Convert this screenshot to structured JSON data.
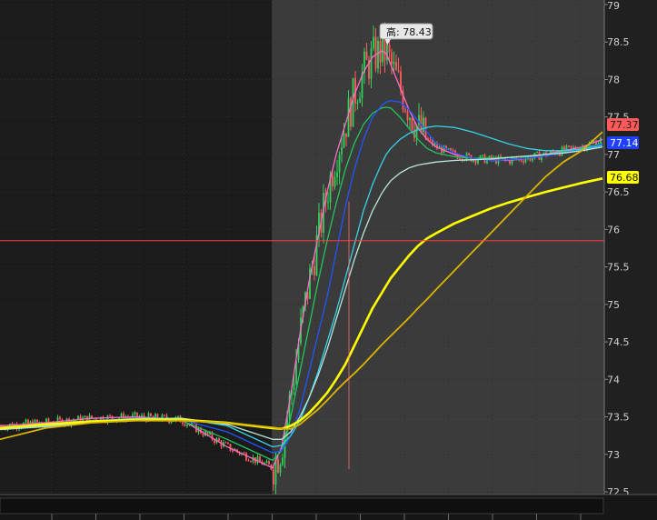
{
  "chart_data": {
    "type": "line",
    "title": "",
    "xlabel": "",
    "ylabel": "",
    "ylim": [
      72.5,
      79
    ],
    "y_ticks": [
      "72.5",
      "73",
      "73.5",
      "74",
      "74.5",
      "75",
      "75.5",
      "76",
      "76.5",
      "77",
      "77.5",
      "78",
      "78.5",
      "79"
    ],
    "grid": true,
    "high_annotation": "高: 78.43",
    "price_badges": [
      {
        "label": "77.37",
        "value": 77.37,
        "color": "#ff5a5a",
        "text_color": "#1a1a1a"
      },
      {
        "label": "77.14",
        "value": 77.14,
        "color": "#2040ff",
        "text_color": "#ffffff"
      },
      {
        "label": "76.68",
        "value": 76.68,
        "color": "#ffff00",
        "text_color": "#1a1a1a"
      }
    ],
    "reference_line": {
      "value": 75.85,
      "color": "#ff3b3b"
    },
    "x": [
      0,
      50,
      100,
      150,
      200,
      250,
      300,
      310,
      320,
      330,
      340,
      350,
      360,
      370,
      380,
      390,
      400,
      410,
      420,
      425,
      430,
      440,
      450,
      460,
      470,
      480,
      500,
      520,
      540,
      560,
      580,
      600,
      620,
      640,
      663
    ],
    "series": [
      {
        "name": "",
        "color": "#ff6ec7",
        "width": 1.3,
        "values": [
          73.38,
          73.42,
          73.48,
          73.5,
          73.46,
          73.1,
          72.82,
          73.1,
          73.8,
          74.6,
          75.3,
          75.9,
          76.5,
          77.0,
          77.4,
          77.8,
          78.1,
          78.3,
          78.38,
          78.35,
          78.2,
          77.9,
          77.6,
          77.35,
          77.2,
          77.1,
          77.0,
          76.95,
          76.93,
          76.92,
          76.95,
          77.0,
          77.05,
          77.1,
          77.2
        ]
      },
      {
        "name": "",
        "color": "#22c55e",
        "width": 1.3,
        "values": [
          73.35,
          73.4,
          73.45,
          73.47,
          73.45,
          73.2,
          72.92,
          73.05,
          73.5,
          74.1,
          74.7,
          75.3,
          75.85,
          76.35,
          76.8,
          77.15,
          77.4,
          77.55,
          77.62,
          77.63,
          77.62,
          77.5,
          77.35,
          77.2,
          77.08,
          77.02,
          76.97,
          76.95,
          76.95,
          76.96,
          76.97,
          77.0,
          77.03,
          77.08,
          77.15
        ]
      },
      {
        "name": "",
        "color": "#2255ff",
        "width": 1.3,
        "values": [
          73.36,
          73.4,
          73.45,
          73.48,
          73.46,
          73.3,
          73.02,
          73.05,
          73.25,
          73.6,
          74.1,
          74.6,
          75.1,
          75.7,
          76.3,
          76.8,
          77.2,
          77.5,
          77.65,
          77.7,
          77.72,
          77.7,
          77.6,
          77.45,
          77.3,
          77.15,
          77.02,
          76.95,
          76.92,
          76.93,
          76.95,
          76.98,
          77.02,
          77.07,
          77.14
        ]
      },
      {
        "name": "",
        "color": "#35d2e6",
        "width": 1.3,
        "values": [
          73.34,
          73.38,
          73.44,
          73.48,
          73.48,
          73.38,
          73.1,
          73.12,
          73.25,
          73.45,
          73.75,
          74.1,
          74.5,
          74.9,
          75.35,
          75.8,
          76.25,
          76.6,
          76.88,
          77.0,
          77.08,
          77.2,
          77.28,
          77.33,
          77.36,
          77.38,
          77.36,
          77.3,
          77.22,
          77.14,
          77.08,
          77.05,
          77.05,
          77.07,
          77.12
        ]
      },
      {
        "name": "",
        "color": "#b8e6dc",
        "width": 1.3,
        "values": [
          73.33,
          73.37,
          73.43,
          73.47,
          73.48,
          73.4,
          73.2,
          73.2,
          73.3,
          73.5,
          73.75,
          74.05,
          74.4,
          74.8,
          75.2,
          75.6,
          75.95,
          76.25,
          76.48,
          76.57,
          76.65,
          76.75,
          76.82,
          76.86,
          76.88,
          76.9,
          76.92,
          76.93,
          76.94,
          76.96,
          76.98,
          77.0,
          77.02,
          77.05,
          77.1
        ]
      },
      {
        "name": "",
        "color": "#ffff00",
        "width": 2.6,
        "values": [
          73.35,
          73.4,
          73.44,
          73.46,
          73.46,
          73.42,
          73.35,
          73.34,
          73.38,
          73.45,
          73.55,
          73.68,
          73.82,
          74.0,
          74.2,
          74.45,
          74.7,
          74.95,
          75.15,
          75.25,
          75.35,
          75.5,
          75.65,
          75.78,
          75.88,
          75.95,
          76.08,
          76.18,
          76.28,
          76.36,
          76.43,
          76.5,
          76.56,
          76.62,
          76.68
        ]
      },
      {
        "name": "",
        "color": "#d9b400",
        "width": 1.8,
        "values": [
          73.2,
          73.35,
          73.42,
          73.45,
          73.45,
          73.42,
          73.36,
          73.34,
          73.34,
          73.4,
          73.5,
          73.6,
          73.72,
          73.85,
          73.97,
          74.08,
          74.2,
          74.33,
          74.46,
          74.52,
          74.58,
          74.7,
          74.82,
          74.95,
          75.07,
          75.2,
          75.45,
          75.7,
          75.95,
          76.2,
          76.45,
          76.7,
          76.9,
          77.05,
          77.3
        ]
      }
    ]
  }
}
